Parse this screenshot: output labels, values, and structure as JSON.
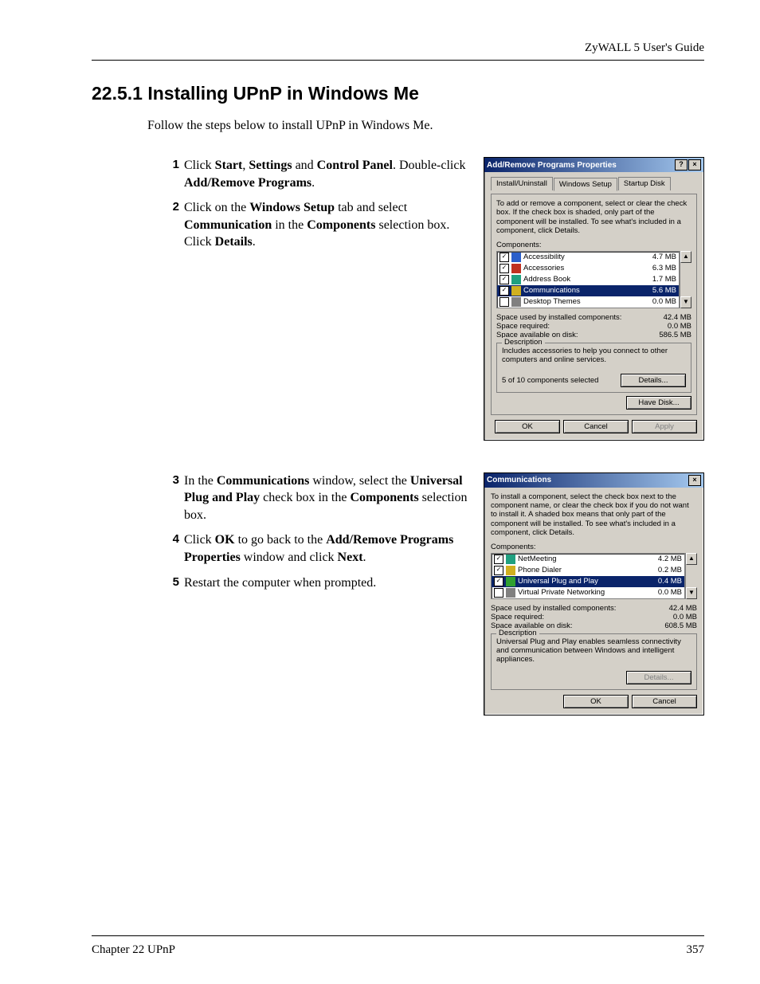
{
  "header": {
    "guide_title": "ZyWALL 5 User's Guide"
  },
  "footer": {
    "chapter": "Chapter 22 UPnP",
    "page_number": "357"
  },
  "section": {
    "heading": "22.5.1  Installing UPnP in Windows Me",
    "intro": "Follow the steps below to install UPnP in Windows Me."
  },
  "steps_a": {
    "n1": "1",
    "s1a": "Click ",
    "s1b": "Start",
    "s1c": ", ",
    "s1d": "Settings",
    "s1e": " and ",
    "s1f": "Control Panel",
    "s1g": ". Double-click ",
    "s1h": "Add/Remove Programs",
    "s1i": ".",
    "n2": "2",
    "s2a": "Click on the ",
    "s2b": "Windows Setup",
    "s2c": " tab and select ",
    "s2d": "Communication",
    "s2e": " in the ",
    "s2f": "Components",
    "s2g": " selection box. Click ",
    "s2h": "Details",
    "s2i": "."
  },
  "steps_b": {
    "n3": "3",
    "s3a": "In the ",
    "s3b": "Communications",
    "s3c": " window, select the ",
    "s3d": "Universal Plug and Play",
    "s3e": " check box in the ",
    "s3f": "Components",
    "s3g": " selection box.",
    "n4": "4",
    "s4a": "Click ",
    "s4b": "OK",
    "s4c": " to go back to the ",
    "s4d": "Add/Remove Programs Properties",
    "s4e": " window and click ",
    "s4f": "Next",
    "s4g": ".",
    "n5": "5",
    "s5": "Restart the computer when prompted."
  },
  "dialog1": {
    "title": "Add/Remove Programs Properties",
    "help_glyph": "?",
    "close_glyph": "×",
    "tabs": {
      "t1": "Install/Uninstall",
      "t2": "Windows Setup",
      "t3": "Startup Disk"
    },
    "instructions": "To add or remove a component, select or clear the check box. If the check box is shaded, only part of the component will be installed. To see what's included in a component, click Details.",
    "components_label": "Components:",
    "items": [
      {
        "name": "Accessibility",
        "size": "4.7 MB",
        "checked": true
      },
      {
        "name": "Accessories",
        "size": "6.3 MB",
        "checked": true
      },
      {
        "name": "Address Book",
        "size": "1.7 MB",
        "checked": true
      },
      {
        "name": "Communications",
        "size": "5.6 MB",
        "checked": true,
        "selected": true
      },
      {
        "name": "Desktop Themes",
        "size": "0.0 MB",
        "checked": false
      }
    ],
    "scroll_up": "▲",
    "scroll_down": "▼",
    "stat1_label": "Space used by installed components:",
    "stat1_val": "42.4 MB",
    "stat2_label": "Space required:",
    "stat2_val": "0.0 MB",
    "stat3_label": "Space available on disk:",
    "stat3_val": "586.5 MB",
    "desc_title": "Description",
    "desc_text": "Includes accessories to help you connect to other computers and online services.",
    "selected_text": "5 of 10 components selected",
    "details_btn": "Details...",
    "have_disk_btn": "Have Disk...",
    "ok_btn": "OK",
    "cancel_btn": "Cancel",
    "apply_btn": "Apply"
  },
  "dialog2": {
    "title": "Communications",
    "close_glyph": "×",
    "instructions": "To install a component, select the check box next to the component name, or clear the check box if you do not want to install it. A shaded box means that only part of the component will be installed. To see what's included in a component, click Details.",
    "components_label": "Components:",
    "items": [
      {
        "name": "NetMeeting",
        "size": "4.2 MB",
        "checked": true
      },
      {
        "name": "Phone Dialer",
        "size": "0.2 MB",
        "checked": true
      },
      {
        "name": "Universal Plug and Play",
        "size": "0.4 MB",
        "checked": true,
        "selected": true
      },
      {
        "name": "Virtual Private Networking",
        "size": "0.0 MB",
        "checked": false
      }
    ],
    "scroll_up": "▲",
    "scroll_down": "▼",
    "stat1_label": "Space used by installed components:",
    "stat1_val": "42.4 MB",
    "stat2_label": "Space required:",
    "stat2_val": "0.0 MB",
    "stat3_label": "Space available on disk:",
    "stat3_val": "608.5 MB",
    "desc_title": "Description",
    "desc_text": "Universal Plug and Play enables seamless connectivity and communication between Windows and intelligent appliances.",
    "details_btn": "Details...",
    "ok_btn": "OK",
    "cancel_btn": "Cancel"
  }
}
